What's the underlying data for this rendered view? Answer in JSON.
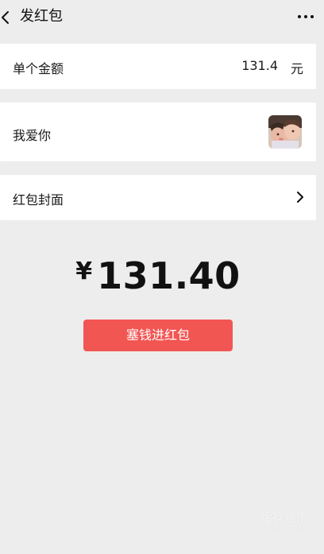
{
  "header": {
    "title": "发红包"
  },
  "amount_row": {
    "label": "单个金额",
    "value": "131.4",
    "unit": "元"
  },
  "greeting_row": {
    "message": "我爱你"
  },
  "cover_row": {
    "label": "红包封面"
  },
  "total": {
    "currency_symbol": "¥",
    "amount": "131.40"
  },
  "send_button": {
    "label": "塞钱进红包"
  },
  "watermark": {
    "main": "搜狗指南",
    "sub": "zhinan.sogou.com"
  },
  "colors": {
    "background": "#ededed",
    "card": "#ffffff",
    "primary_button": "#f25653"
  },
  "icons": {
    "back": "back-arrow-icon",
    "more": "more-dots-icon",
    "chevron": "chevron-right-icon"
  }
}
